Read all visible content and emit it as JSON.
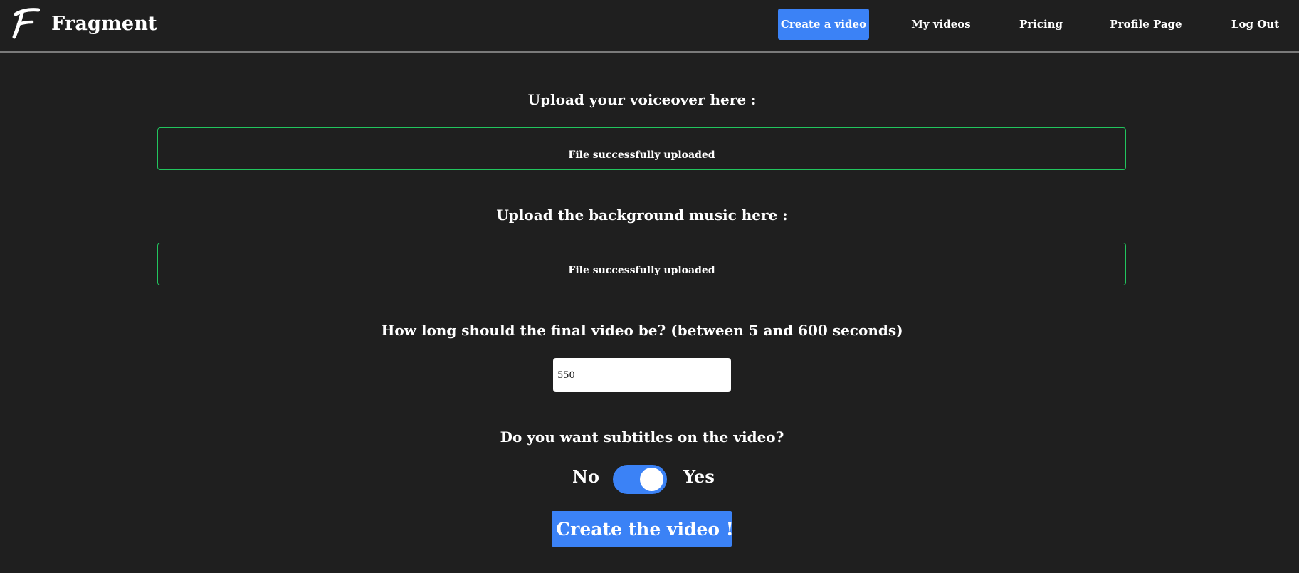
{
  "brand": {
    "logo_icon": "fragment-f-logo-icon",
    "name": "Fragment"
  },
  "nav": {
    "items": [
      {
        "label": "Create a video",
        "active": true
      },
      {
        "label": "My videos",
        "active": false
      },
      {
        "label": "Pricing",
        "active": false
      },
      {
        "label": "Profile Page",
        "active": false
      },
      {
        "label": "Log Out",
        "active": false
      }
    ],
    "accent_color": "#3b82f6"
  },
  "voiceover": {
    "title": "Upload your voiceover here :",
    "status": "File successfully uploaded"
  },
  "music": {
    "title": "Upload the background music here :",
    "status": "File successfully uploaded"
  },
  "duration": {
    "question": "How long should the final video be? (between 5 and 600 seconds)",
    "value": "550"
  },
  "subtitles": {
    "question": "Do you want subtitles on the video?",
    "off_label": "No",
    "on_label": "Yes",
    "enabled": true
  },
  "submit": {
    "icon": "rocket-icon",
    "label": "Create the video !"
  },
  "colors": {
    "background": "#1f1f1f",
    "success_border": "#22c55e",
    "primary": "#3b82f6"
  }
}
